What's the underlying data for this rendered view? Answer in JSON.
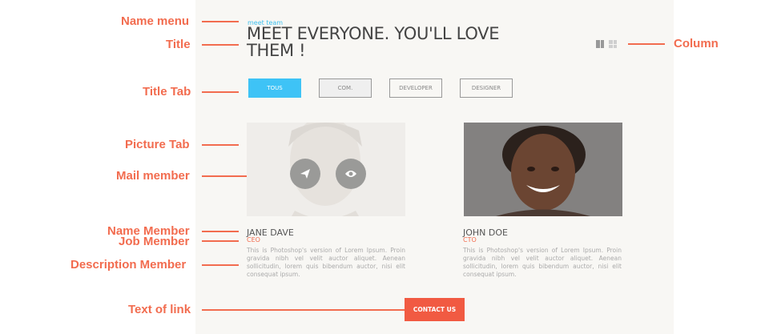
{
  "annotations": {
    "name_menu": "Name menu",
    "title": "Title",
    "title_tab": "Title Tab",
    "picture_tab": "Picture Tab",
    "mail_member": "Mail member",
    "name_member": "Name Member",
    "job_member": "Job Member",
    "description_member": "Description Member",
    "text_of_link": "Text of link",
    "column": "Column"
  },
  "header": {
    "menu_name": "meet team",
    "title": "MEET EVERYONE. YOU'LL LOVE THEM !"
  },
  "tabs": [
    {
      "label": "TOUS",
      "state": "active"
    },
    {
      "label": "COM.",
      "state": "hover"
    },
    {
      "label": "DEVELOPER",
      "state": "default"
    },
    {
      "label": "DESIGNER",
      "state": "default"
    }
  ],
  "members": [
    {
      "name": "JANE DAVE",
      "job": "CEO",
      "description": "This is Photoshop's version  of Lorem Ipsum. Proin gravida nibh vel velit auctor aliquet. Aenean sollicitudin, lorem quis bibendum auctor, nisi elit consequat ipsum."
    },
    {
      "name": "JOHN DOE",
      "job": "CTO",
      "description": "This is Photoshop's version  of Lorem Ipsum. Proin gravida nibh vel velit auctor aliquet. Aenean sollicitudin, lorem quis bibendum auctor, nisi elit consequat ipsum."
    }
  ],
  "link": {
    "label": "CONTACT US"
  },
  "colors": {
    "accent_annotation": "#f26c4f",
    "tab_active": "#3ec3f6",
    "job": "#f26c4f",
    "contact_button": "#f15a42"
  },
  "icons": {
    "send": "paper-plane-icon",
    "view": "eye-icon",
    "columns_two": "two-column-icon",
    "columns_four": "four-grid-icon"
  }
}
